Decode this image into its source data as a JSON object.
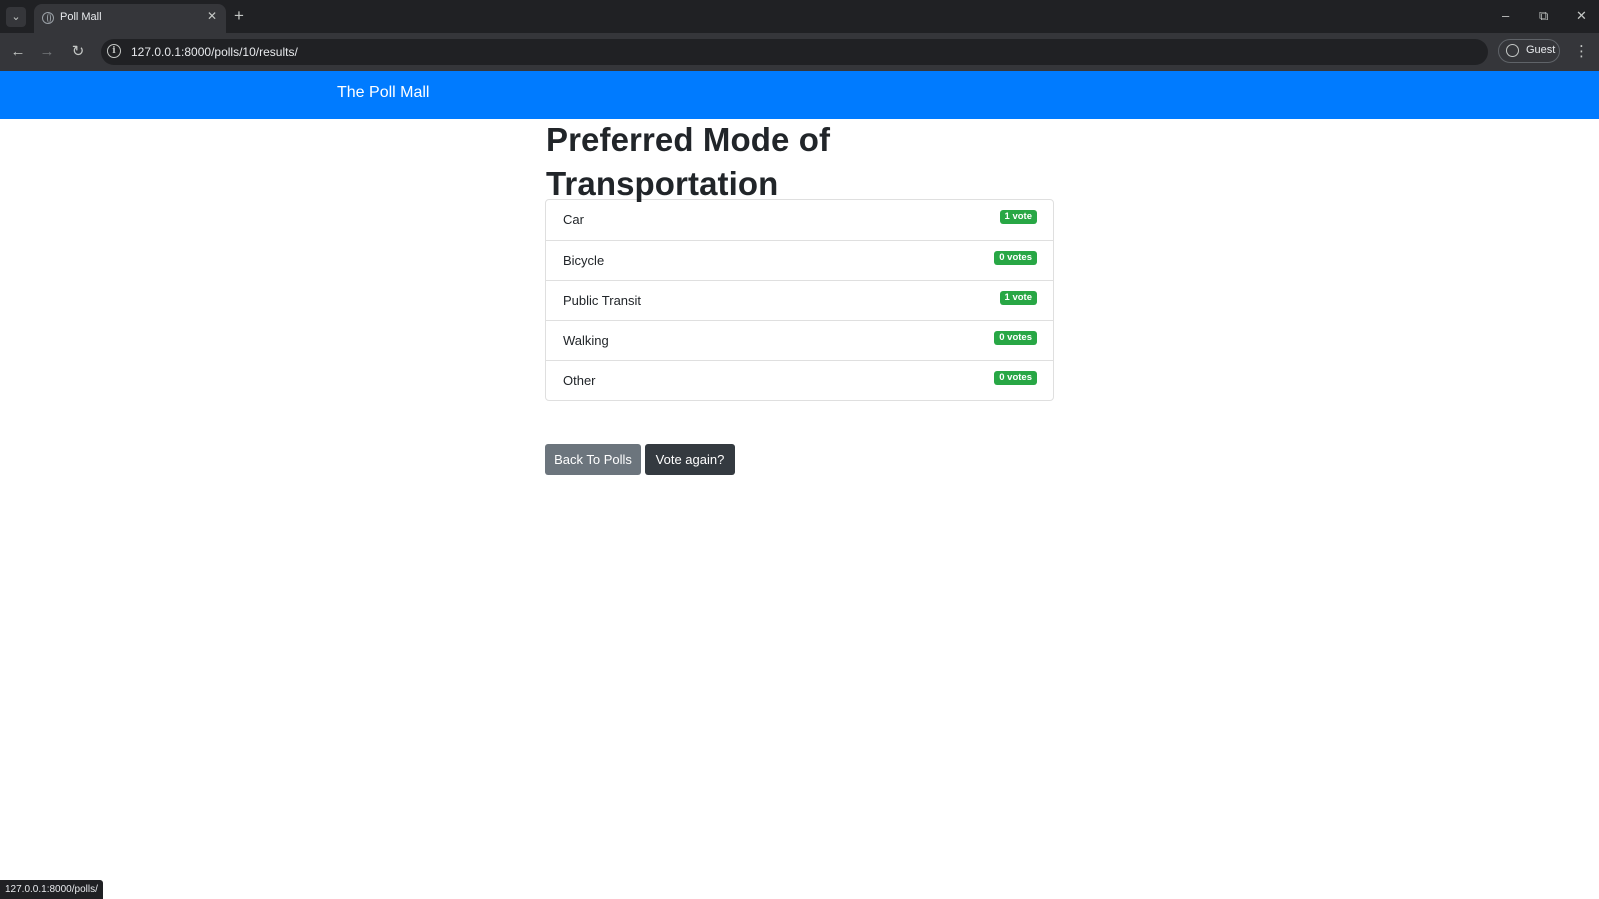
{
  "browser": {
    "tab_title": "Poll Mall",
    "url": "127.0.0.1:8000/polls/10/results/",
    "profile_label": "Guest",
    "status_url": "127.0.0.1:8000/polls/"
  },
  "navbar": {
    "brand": "The Poll Mall",
    "color": "#007bff"
  },
  "poll": {
    "question": "Preferred Mode of Transportation",
    "choices": [
      {
        "label": "Car",
        "votes_text": "1 vote",
        "votes": 1
      },
      {
        "label": "Bicycle",
        "votes_text": "0 votes",
        "votes": 0
      },
      {
        "label": "Public Transit",
        "votes_text": "1 vote",
        "votes": 1
      },
      {
        "label": "Walking",
        "votes_text": "0 votes",
        "votes": 0
      },
      {
        "label": "Other",
        "votes_text": "0 votes",
        "votes": 0
      }
    ],
    "badge_color": "#28a745"
  },
  "actions": {
    "back_label": "Back To Polls",
    "vote_again_label": "Vote again?"
  },
  "icons": {
    "tab_search": "chevron-down-icon",
    "favicon": "globe-icon",
    "tab_close": "close-icon",
    "new_tab": "plus-icon",
    "back": "arrow-left-icon",
    "forward": "arrow-right-icon",
    "reload": "reload-icon",
    "site_info": "info-icon",
    "profile": "user-circle-icon",
    "menu": "more-vert-icon"
  }
}
